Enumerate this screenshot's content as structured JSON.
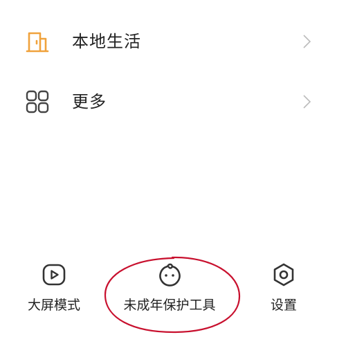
{
  "menu": {
    "items": [
      {
        "label": "本地生活",
        "icon": "door-icon",
        "icon_color": "#F0A23C"
      },
      {
        "label": "更多",
        "icon": "grid-icon",
        "icon_color": "#444444"
      }
    ]
  },
  "bottom_tools": {
    "items": [
      {
        "label": "大屏模式",
        "icon": "play-screen-icon"
      },
      {
        "label": "未成年保护工具",
        "icon": "child-face-icon"
      },
      {
        "label": "设置",
        "icon": "hexagon-settings-icon"
      }
    ]
  },
  "colors": {
    "text": "#222222",
    "accent_orange": "#F0A23C",
    "chevron": "#BBBBBB",
    "annotation_red": "#C8102E"
  }
}
